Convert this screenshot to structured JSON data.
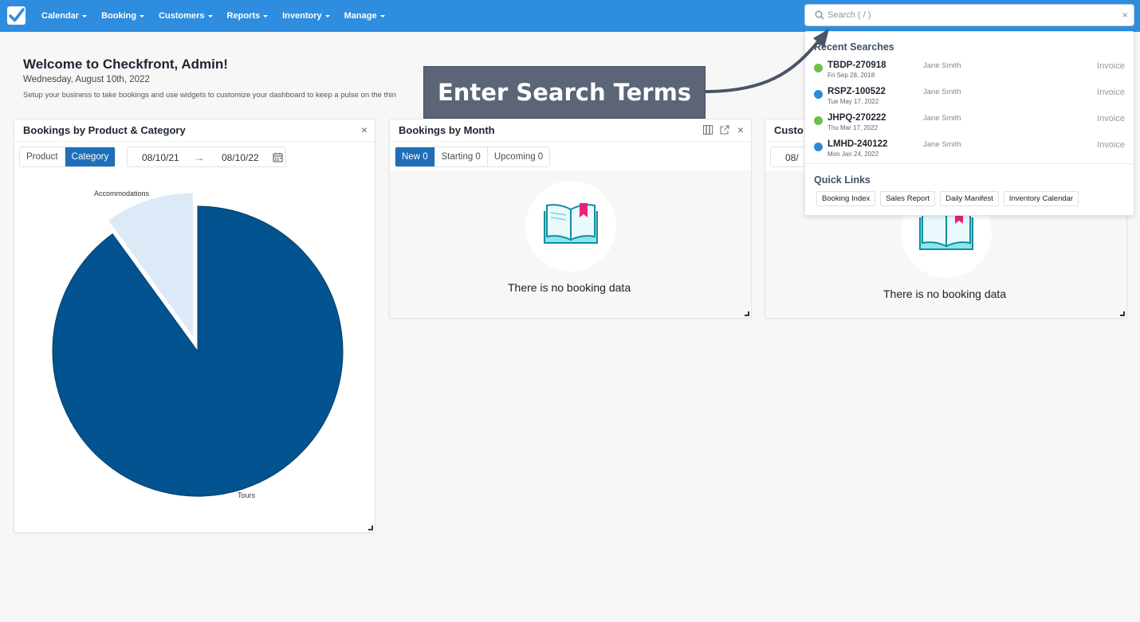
{
  "nav": {
    "logo_icon": "checkmark-logo-icon",
    "items": [
      "Calendar",
      "Booking",
      "Customers",
      "Reports",
      "Inventory",
      "Manage"
    ]
  },
  "search": {
    "placeholder": "Search ( / )",
    "value": "",
    "icon": "search-icon",
    "clear_icon": "×"
  },
  "welcome": {
    "title": "Welcome to Checkfront, Admin!",
    "date": "Wednesday, August 10th, 2022",
    "subtitle": "Setup your business to take bookings and use widgets to customize your dashboard to keep a pulse on the thin"
  },
  "widgets": {
    "product_category": {
      "title": "Bookings by Product & Category",
      "close": "×",
      "toggles": [
        "Product",
        "Category"
      ],
      "active_toggle": "Category",
      "date_from": "08/10/21",
      "date_arrow": "→",
      "date_to": "08/10/22",
      "calendar_icon": "calendar-icon"
    },
    "by_month": {
      "title": "Bookings by Month",
      "close": "×",
      "tabs": [
        "New 0",
        "Starting 0",
        "Upcoming 0"
      ],
      "active_tab": "New 0",
      "empty_text": "There is no booking data",
      "empty_icon": "open-book-icon"
    },
    "customers": {
      "title": "Custo",
      "date_from": "08/",
      "empty_text": "There is no booking data"
    }
  },
  "chart_data": {
    "type": "pie",
    "title": "",
    "slices": [
      {
        "label": "Tours",
        "value": 90,
        "color": "#02538f"
      },
      {
        "label": "Accommodations",
        "value": 10,
        "color": "#dce9f7"
      }
    ]
  },
  "search_dropdown": {
    "recent_heading": "Recent Searches",
    "recent": [
      {
        "code": "TBDP-270918",
        "date": "Fri Sep 28, 2018",
        "person": "Jane Smith",
        "type": "Invoice",
        "color": "#6cc04a"
      },
      {
        "code": "RSPZ-100522",
        "date": "Tue May 17, 2022",
        "person": "Jane Smith",
        "type": "Invoice",
        "color": "#2f8ad6"
      },
      {
        "code": "JHPQ-270222",
        "date": "Thu Mar 17, 2022",
        "person": "Jane Smith",
        "type": "Invoice",
        "color": "#6cc04a"
      },
      {
        "code": "LMHD-240122",
        "date": "Mon Jan 24, 2022",
        "person": "Jane Smith",
        "type": "Invoice",
        "color": "#2f8ad6"
      }
    ],
    "quick_heading": "Quick Links",
    "quick_links": [
      "Booking Index",
      "Sales Report",
      "Daily Manifest",
      "Inventory Calendar"
    ]
  },
  "callout": {
    "text": "Enter Search Terms"
  }
}
